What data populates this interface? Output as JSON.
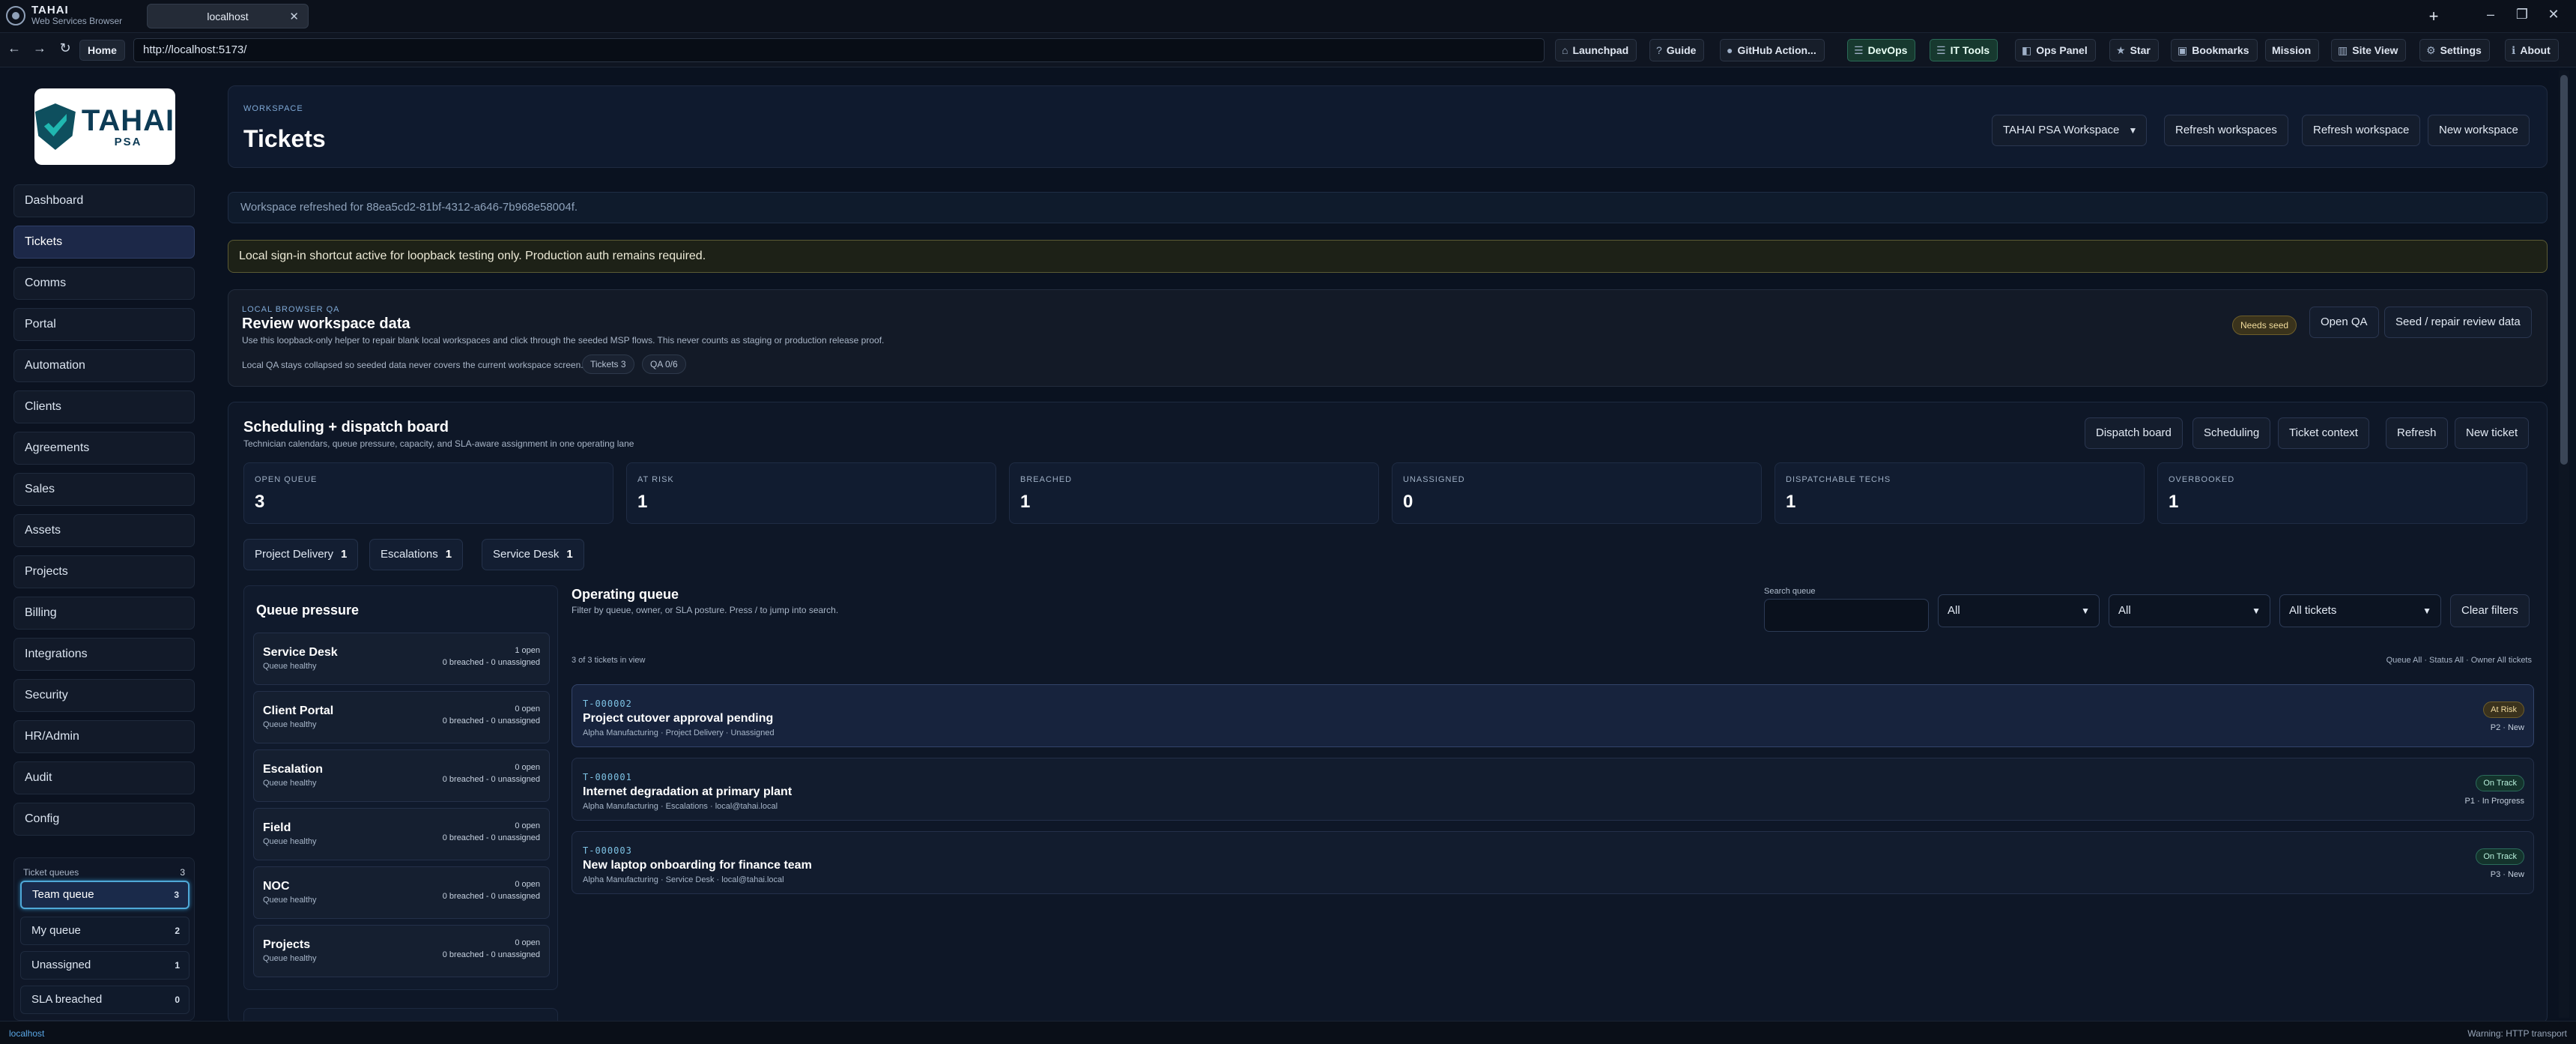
{
  "browser": {
    "brand_name": "TAHAI",
    "brand_sub": "Web Services Browser",
    "tab_title": "localhost",
    "url": "http://localhost:5173/",
    "home_label": "Home",
    "tools": [
      {
        "label": "Launchpad",
        "icon": "⌂"
      },
      {
        "label": "Guide",
        "icon": "?"
      },
      {
        "label": "GitHub Action...",
        "icon": "●"
      },
      {
        "label": "DevOps",
        "icon": "☰"
      },
      {
        "label": "IT Tools",
        "icon": "☰"
      },
      {
        "label": "Ops Panel",
        "icon": "◧"
      },
      {
        "label": "Star",
        "icon": "★"
      },
      {
        "label": "Bookmarks",
        "icon": "▣"
      },
      {
        "label": "Mission",
        "icon": ""
      },
      {
        "label": "Site View",
        "icon": "▥"
      },
      {
        "label": "Settings",
        "icon": "⚙"
      },
      {
        "label": "About",
        "icon": "ℹ"
      }
    ],
    "status_left": "localhost",
    "status_right": "Warning: HTTP transport"
  },
  "sidebar": {
    "logo_text": "TAHAI",
    "logo_sub": "PSA",
    "items": [
      "Dashboard",
      "Tickets",
      "Comms",
      "Portal",
      "Automation",
      "Clients",
      "Agreements",
      "Sales",
      "Assets",
      "Projects",
      "Billing",
      "Integrations",
      "Security",
      "HR/Admin",
      "Audit",
      "Config"
    ],
    "active_item": "Tickets",
    "queues_title": "Ticket queues",
    "queues_count": "3",
    "queues": [
      {
        "label": "Team queue",
        "count": "3"
      },
      {
        "label": "My queue",
        "count": "2"
      },
      {
        "label": "Unassigned",
        "count": "1"
      },
      {
        "label": "SLA breached",
        "count": "0"
      }
    ]
  },
  "header": {
    "eyebrow": "WORKSPACE",
    "title": "Tickets",
    "workspace_select": "TAHAI PSA Workspace",
    "refresh_workspaces": "Refresh workspaces",
    "refresh_workspace": "Refresh workspace",
    "new_workspace": "New workspace"
  },
  "notice": "Workspace refreshed for 88ea5cd2-81bf-4312-a646-7b968e58004f.",
  "warning": "Local sign-in shortcut active for loopback testing only. Production auth remains required.",
  "qa": {
    "eyebrow": "LOCAL BROWSER QA",
    "title": "Review workspace data",
    "desc": "Use this loopback-only helper to repair blank local workspaces and click through the seeded MSP flows. This never counts as staging or production release proof.",
    "note": "Local QA stays collapsed so seeded data never covers the current workspace screen.",
    "chip_tickets": "Tickets 3",
    "chip_qa": "QA 0/6",
    "badge": "Needs seed",
    "open_qa": "Open QA",
    "seed": "Seed / repair review data"
  },
  "board": {
    "title": "Scheduling + dispatch board",
    "subtitle": "Technician calendars, queue pressure, capacity, and SLA-aware assignment in one operating lane",
    "actions": [
      "Dispatch board",
      "Scheduling",
      "Ticket context",
      "Refresh",
      "New ticket"
    ],
    "stats": [
      {
        "label": "OPEN QUEUE",
        "value": "3"
      },
      {
        "label": "AT RISK",
        "value": "1"
      },
      {
        "label": "BREACHED",
        "value": "1"
      },
      {
        "label": "UNASSIGNED",
        "value": "0"
      },
      {
        "label": "DISPATCHABLE TECHS",
        "value": "1"
      },
      {
        "label": "OVERBOOKED",
        "value": "1"
      }
    ],
    "pills": [
      {
        "label": "Project Delivery",
        "count": "1"
      },
      {
        "label": "Escalations",
        "count": "1"
      },
      {
        "label": "Service Desk",
        "count": "1"
      }
    ]
  },
  "pressure": {
    "title": "Queue pressure",
    "queues": [
      {
        "name": "Service Desk",
        "health": "Queue healthy",
        "open": "1 open",
        "breach": "0 breached - 0 unassigned"
      },
      {
        "name": "Client Portal",
        "health": "Queue healthy",
        "open": "0 open",
        "breach": "0 breached - 0 unassigned"
      },
      {
        "name": "Escalation",
        "health": "Queue healthy",
        "open": "0 open",
        "breach": "0 breached - 0 unassigned"
      },
      {
        "name": "Field",
        "health": "Queue healthy",
        "open": "0 open",
        "breach": "0 breached - 0 unassigned"
      },
      {
        "name": "NOC",
        "health": "Queue healthy",
        "open": "0 open",
        "breach": "0 breached - 0 unassigned"
      },
      {
        "name": "Projects",
        "health": "Queue healthy",
        "open": "0 open",
        "breach": "0 breached - 0 unassigned"
      }
    ]
  },
  "queue": {
    "title": "Operating queue",
    "subtitle": "Filter by queue, owner, or SLA posture. Press / to jump into search.",
    "search_label": "Search queue",
    "search_value": "",
    "filter_1": "All",
    "filter_2": "All",
    "filter_3": "All tickets",
    "clear": "Clear filters",
    "count_line": "3 of 3 tickets in view",
    "filter_line": "Queue All · Status All · Owner All tickets",
    "tickets": [
      {
        "id": "T-000002",
        "title": "Project cutover approval pending",
        "meta": "Alpha Manufacturing · Project Delivery · Unassigned",
        "badge": "At Risk",
        "pri": "P2 · New"
      },
      {
        "id": "T-000001",
        "title": "Internet degradation at primary plant",
        "meta": "Alpha Manufacturing · Escalations · local@tahai.local",
        "badge": "On Track",
        "pri": "P1 · In Progress"
      },
      {
        "id": "T-000003",
        "title": "New laptop onboarding for finance team",
        "meta": "Alpha Manufacturing · Service Desk · local@tahai.local",
        "badge": "On Track",
        "pri": "P3 · New"
      }
    ]
  }
}
